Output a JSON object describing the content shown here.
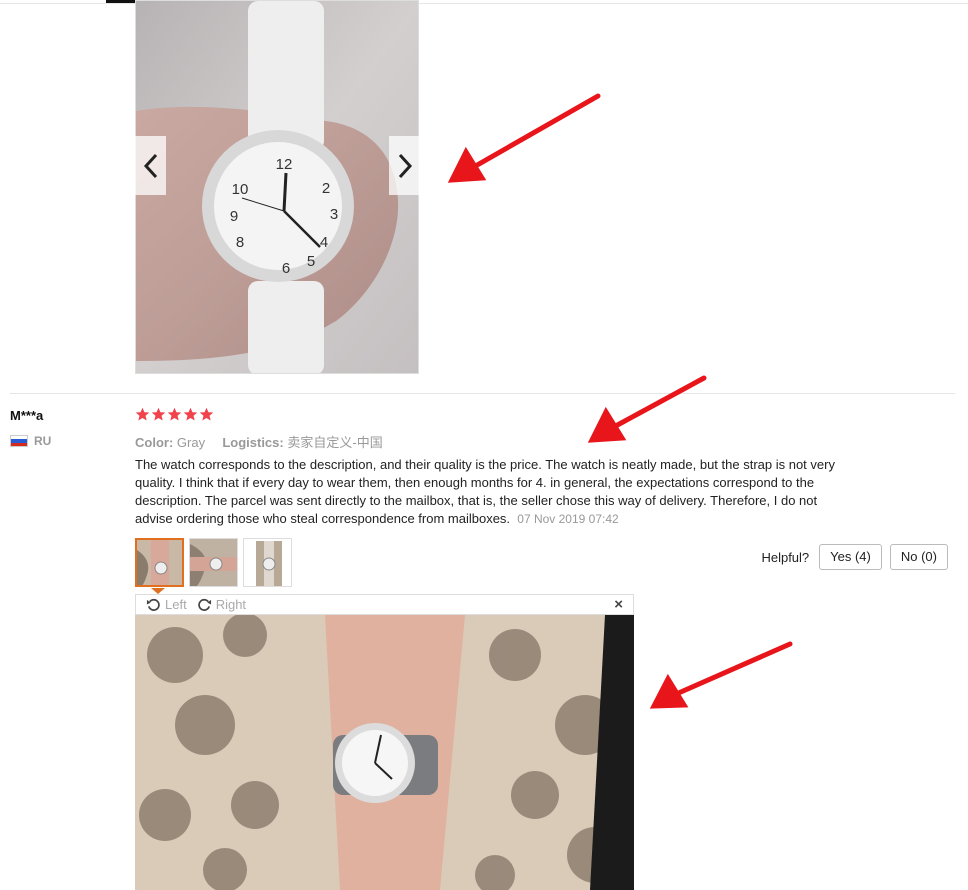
{
  "review": {
    "user_name": "M***a",
    "country_code": "RU",
    "rating": 5,
    "color_label": "Color:",
    "color_value": "Gray",
    "logistics_label": "Logistics:",
    "logistics_value": "卖家自定义-中国",
    "text": "The watch corresponds to the description, and their quality is the price. The watch is neatly made, but the strap is not very quality. I think that if every day to wear them, then enough months for 4. in general, the expectations correspond to the description. The parcel was sent directly to the mailbox, that is, the seller chose this way of delivery. Therefore, I do not advise ordering those who steal correspondence from mailboxes.",
    "date": "07 Nov 2019 07:42"
  },
  "helpful": {
    "label": "Helpful?",
    "yes_label": "Yes (4)",
    "no_label": "No (0)"
  },
  "viewer": {
    "rotate_left_label": "Left",
    "rotate_right_label": "Right",
    "close_symbol": "×"
  },
  "colors": {
    "star": "#f0424b",
    "accent": "#e07020",
    "arrow": "#e8161b"
  }
}
